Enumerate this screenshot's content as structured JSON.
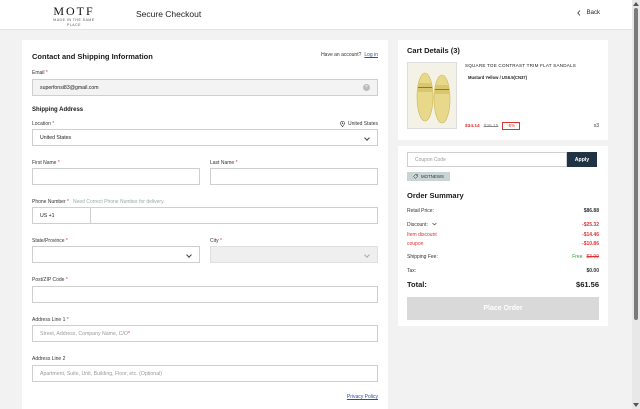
{
  "header": {
    "logo": "MOTF",
    "logo_sub": "MADE IN THE SAME PLACE",
    "title": "Secure Checkout",
    "back_label": "Back"
  },
  "contact": {
    "title": "Contact and Shipping Information",
    "has_account": "Have an account?",
    "login_label": "Log in",
    "email_label": "Email",
    "email_value": "superfonsi83@gmail.com"
  },
  "shipping": {
    "title": "Shipping Address",
    "location_label": "Location",
    "location_right": "United States",
    "location_value": "United States",
    "first_name_label": "First Name",
    "last_name_label": "Last Name",
    "phone_label": "Phone Number",
    "phone_hint": "Need Correct Phone Number for delivery.",
    "phone_code": "US +1",
    "state_label": "State/Province",
    "city_label": "City",
    "zip_label": "Post/ZIP Code",
    "address1_label": "Address Line 1",
    "address1_placeholder": "Street, Address, Company Name, C/O",
    "address2_label": "Address Line 2",
    "address2_placeholder": "Apartment, Suite, Unit, Building, Floor, etc. (Optional)",
    "privacy_label": "Privacy Policy"
  },
  "cart": {
    "title": "Cart Details (3)",
    "product_name": "SQUARE TOE CONTRAST TRIM FLAT SANDALS",
    "variant": "Mustard Yellow / US6.5(CN37)",
    "price_sale": "$34.14",
    "price_orig": "$36.15",
    "discount": "-5%",
    "qty": "x3"
  },
  "summary": {
    "coupon_placeholder": "Coupon Code",
    "apply_label": "Apply",
    "coupon_tag": "MOTNEWS",
    "title": "Order Summary",
    "retail_label": "Retail Price:",
    "retail_value": "$86.88",
    "discount_label": "Discount:",
    "discount_value": "-$25.32",
    "item_discount_label": "Item discount",
    "item_discount_value": "-$14.46",
    "coupon_label": "coupon",
    "coupon_value": "-$10.86",
    "shipping_label": "Shipping Fee:",
    "shipping_free": "Free",
    "shipping_orig": "$3.99",
    "tax_label": "Tax:",
    "tax_value": "$0.00",
    "total_label": "Total:",
    "total_value": "$61.56",
    "place_order_label": "Place Order"
  },
  "colors": {
    "accent_dark": "#1f3344",
    "discount_red": "#dd3333",
    "link_blue": "#2b4ea3",
    "free_green": "#2a9a3a"
  }
}
